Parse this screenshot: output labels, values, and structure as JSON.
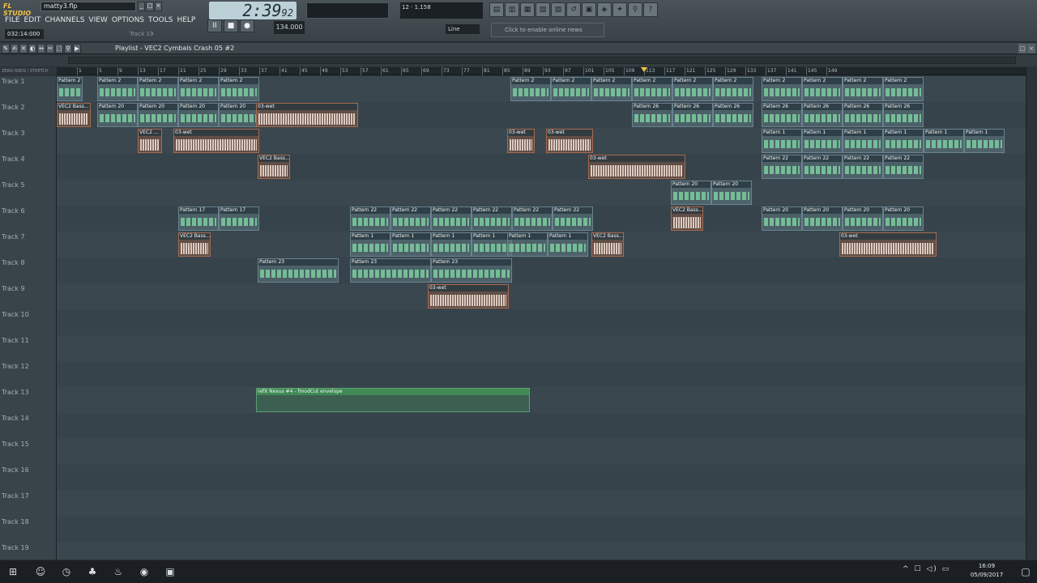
{
  "app": {
    "logo": "FL STUDIO",
    "project_file": "matty3.flp"
  },
  "menu": [
    "FILE",
    "EDIT",
    "CHANNELS",
    "VIEW",
    "OPTIONS",
    "TOOLS",
    "HELP"
  ],
  "status": {
    "time": "032:14:000",
    "hint": "Track 19",
    "clock_main": "2:39",
    "clock_sub": "92",
    "tempo": "134.000",
    "cpu": "12",
    "ram": "1.158",
    "line_mode": "Line",
    "news": "Click to enable online news"
  },
  "transport": {
    "pause": "II",
    "stop": "■",
    "record": "●"
  },
  "playlist": {
    "title": "Playlist - VEC2 Cymbals Crash 05 #2",
    "left_label": "ZERO-SNDS / STRETCH"
  },
  "ruler": [
    "1",
    "5",
    "9",
    "13",
    "17",
    "21",
    "25",
    "29",
    "33",
    "37",
    "41",
    "45",
    "49",
    "53",
    "57",
    "61",
    "65",
    "69",
    "73",
    "77",
    "81",
    "85",
    "89",
    "93",
    "97",
    "101",
    "105",
    "109",
    "113",
    "117",
    "121",
    "125",
    "129",
    "133",
    "137",
    "141",
    "145",
    "149"
  ],
  "tracks": [
    "Track 1",
    "Track 2",
    "Track 3",
    "Track 4",
    "Track 5",
    "Track 6",
    "Track 7",
    "Track 8",
    "Track 9",
    "Track 10",
    "Track 11",
    "Track 12",
    "Track 13",
    "Track 14",
    "Track 15",
    "Track 16",
    "Track 17",
    "Track 18",
    "Track 19"
  ],
  "clips": {
    "pattern2": "Pattern 2",
    "pattern20": "Pattern 20",
    "pattern26": "Pattern 26",
    "pattern1": "Pattern 1",
    "pattern22": "Pattern 22",
    "pattern17": "Pattern 17",
    "pattern23": "Pattern 23",
    "wet": "03-wet",
    "vec2bass": "VEC2 Bass...",
    "vec2": "VEC2 ...",
    "automation": "refX Nexus #4 - fmodCut envelope"
  },
  "taskbar": {
    "time": "16:09",
    "date": "05/09/2017"
  }
}
